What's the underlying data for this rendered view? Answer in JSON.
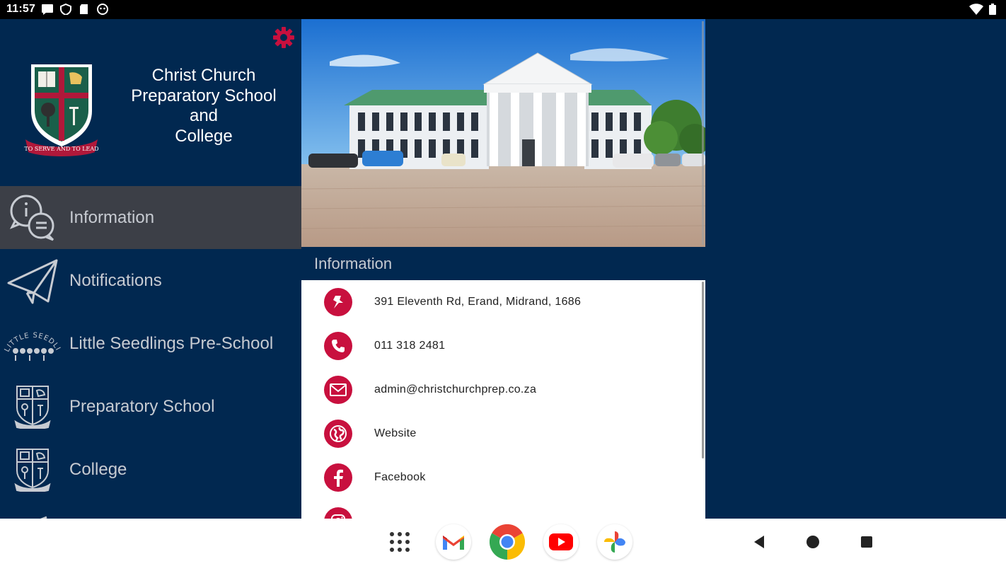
{
  "status_bar": {
    "time": "11:57",
    "icons": [
      "message-icon",
      "shield-icon",
      "sd-card-icon",
      "face-icon",
      "wifi-icon",
      "battery-icon"
    ]
  },
  "sidebar": {
    "school_name": "Christ Church\nPreparatory School\nand\nCollege",
    "crest_motto": "TO SERVE AND TO LEAD",
    "items": [
      {
        "label": "Information",
        "icon": "info-chat-icon",
        "active": true
      },
      {
        "label": "Notifications",
        "icon": "paper-plane-icon",
        "active": false
      },
      {
        "label": "Little Seedlings Pre-School",
        "icon": "little-seedlings-logo",
        "logo_text": "LITTLE SEEDLINGS",
        "active": false
      },
      {
        "label": "Preparatory School",
        "icon": "school-crest-icon",
        "active": false
      },
      {
        "label": "College",
        "icon": "school-crest-icon",
        "active": false
      }
    ]
  },
  "main": {
    "section_title": "Information",
    "contacts": [
      {
        "icon": "pin-icon",
        "text": "391 Eleventh Rd, Erand, Midrand, 1686"
      },
      {
        "icon": "phone-icon",
        "text": "011 318 2481"
      },
      {
        "icon": "mail-icon",
        "text": "admin@christchurchprep.co.za"
      },
      {
        "icon": "globe-icon",
        "text": "Website"
      },
      {
        "icon": "facebook-icon",
        "text": "Facebook"
      },
      {
        "icon": "instagram-icon",
        "text": ""
      }
    ]
  },
  "nav_bar": {
    "apps": [
      "app-drawer-icon",
      "gmail-icon",
      "chrome-icon",
      "youtube-icon",
      "photos-icon"
    ],
    "system": [
      "back-icon",
      "home-icon",
      "recents-icon"
    ]
  },
  "colors": {
    "navy": "#012850",
    "accent_red": "#c8103e",
    "active_row": "#3c3f47",
    "nav_text": "#c7cbd2"
  }
}
